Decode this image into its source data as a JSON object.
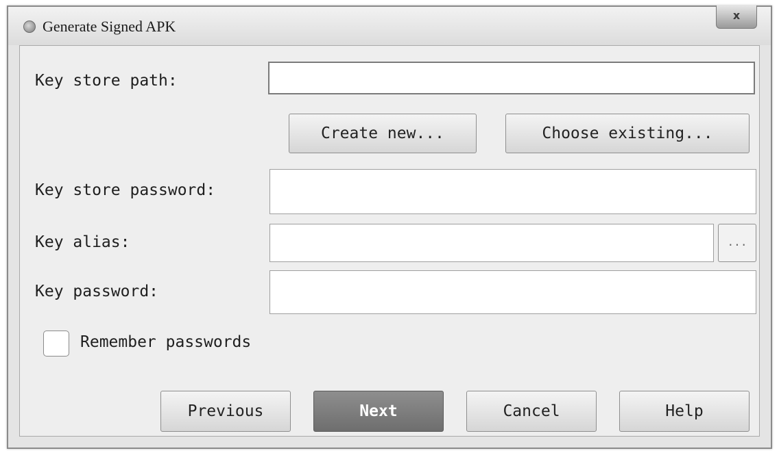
{
  "window": {
    "title": "Generate Signed APK",
    "close_label": "x"
  },
  "form": {
    "key_store_path": {
      "label": "Key store path:",
      "value": ""
    },
    "create_new_label": "Create new...",
    "choose_existing_label": "Choose existing...",
    "key_store_password": {
      "label": "Key store password:",
      "value": ""
    },
    "key_alias": {
      "label": "Key alias:",
      "value": "",
      "browse_label": "..."
    },
    "key_password": {
      "label": "Key password:",
      "value": ""
    },
    "remember_passwords": {
      "label": "Remember passwords",
      "checked": false
    }
  },
  "footer": {
    "previous_label": "Previous",
    "next_label": "Next",
    "cancel_label": "Cancel",
    "help_label": "Help"
  },
  "icons": {
    "title_icon": "android-studio-icon",
    "close_icon": "close-icon"
  }
}
